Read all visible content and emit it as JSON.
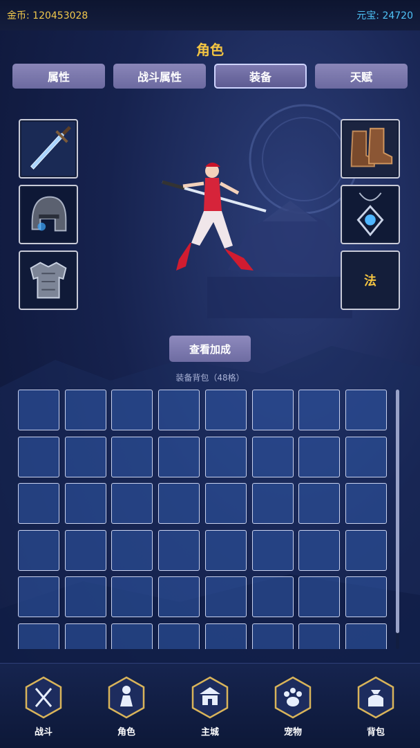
{
  "currency": {
    "gold_label": "金币: 120453028",
    "gem_label": "元宝: 24720"
  },
  "page_title": "角色",
  "tabs": [
    {
      "label": "属性",
      "active": false
    },
    {
      "label": "战斗属性",
      "active": false
    },
    {
      "label": "装备",
      "active": true
    },
    {
      "label": "天赋",
      "active": false
    }
  ],
  "equipment": {
    "left_slots": [
      "sword-icon",
      "helmet-icon",
      "armor-icon"
    ],
    "right_slots": [
      "boots-icon",
      "amulet-icon"
    ],
    "skill_slot_text": "法"
  },
  "bonus_button": "查看加成",
  "bag": {
    "label": "装备背包（48格）",
    "columns": 8,
    "cell_count": 48
  },
  "nav": [
    {
      "label": "战斗",
      "icon": "battle-icon"
    },
    {
      "label": "角色",
      "icon": "character-icon"
    },
    {
      "label": "主城",
      "icon": "city-icon"
    },
    {
      "label": "宠物",
      "icon": "pet-paw-icon"
    },
    {
      "label": "背包",
      "icon": "bag-icon"
    }
  ],
  "colors": {
    "gold": "#f2c94c",
    "gem": "#4fc3f7",
    "title": "#f4c542"
  }
}
